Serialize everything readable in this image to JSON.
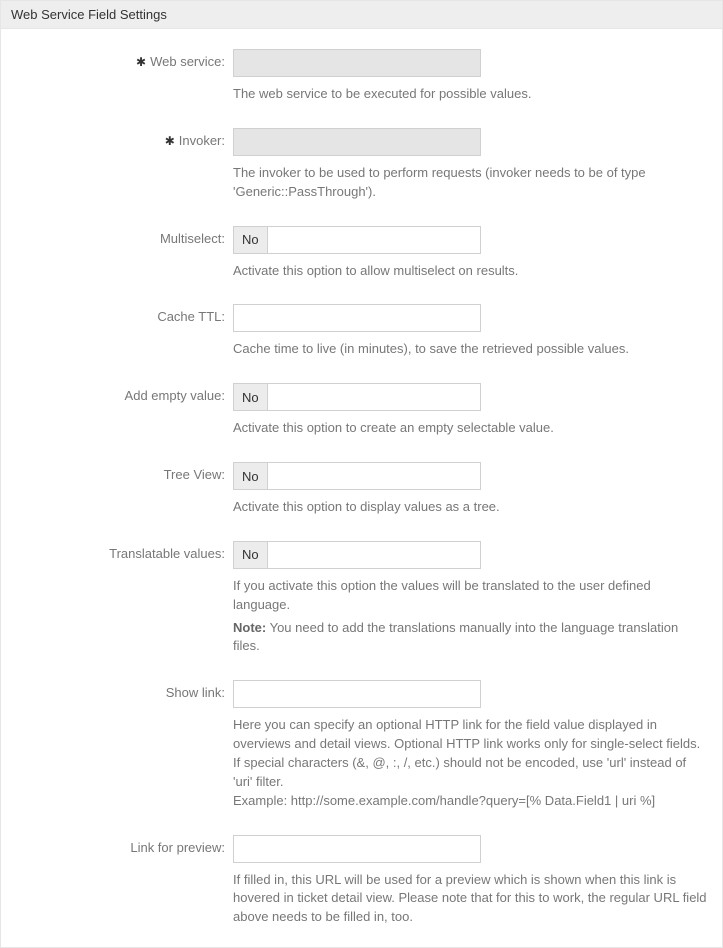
{
  "panel": {
    "title": "Web Service Field Settings"
  },
  "fields": {
    "web_service": {
      "label": "Web service:",
      "required_mark": "✱",
      "value": "",
      "help": "The web service to be executed for possible values."
    },
    "invoker": {
      "label": "Invoker:",
      "required_mark": "✱",
      "value": "",
      "help": "The invoker to be used to perform requests (invoker needs to be of type 'Generic::PassThrough')."
    },
    "multiselect": {
      "label": "Multiselect:",
      "value": "No",
      "help": "Activate this option to allow multiselect on results."
    },
    "cache_ttl": {
      "label": "Cache TTL:",
      "value": "",
      "help": "Cache time to live (in minutes), to save the retrieved possible values."
    },
    "add_empty": {
      "label": "Add empty value:",
      "value": "No",
      "help": "Activate this option to create an empty selectable value."
    },
    "tree_view": {
      "label": "Tree View:",
      "value": "No",
      "help": "Activate this option to display values as a tree."
    },
    "translatable": {
      "label": "Translatable values:",
      "value": "No",
      "help1": "If you activate this option the values will be translated to the user defined language.",
      "note_label": "Note:",
      "note_text": " You need to add the translations manually into the language translation files."
    },
    "show_link": {
      "label": "Show link:",
      "value": "",
      "help1": "Here you can specify an optional HTTP link for the field value displayed in overviews and detail views. Optional HTTP link works only for single-select fields.",
      "help2": "If special characters (&, @, :, /, etc.) should not be encoded, use 'url' instead of 'uri' filter.",
      "help3": "Example: http://some.example.com/handle?query=[% Data.Field1 | uri %]"
    },
    "link_preview": {
      "label": "Link for preview:",
      "value": "",
      "help": "If filled in, this URL will be used for a preview which is shown when this link is hovered in ticket detail view. Please note that for this to work, the regular URL field above needs to be filled in, too."
    }
  }
}
